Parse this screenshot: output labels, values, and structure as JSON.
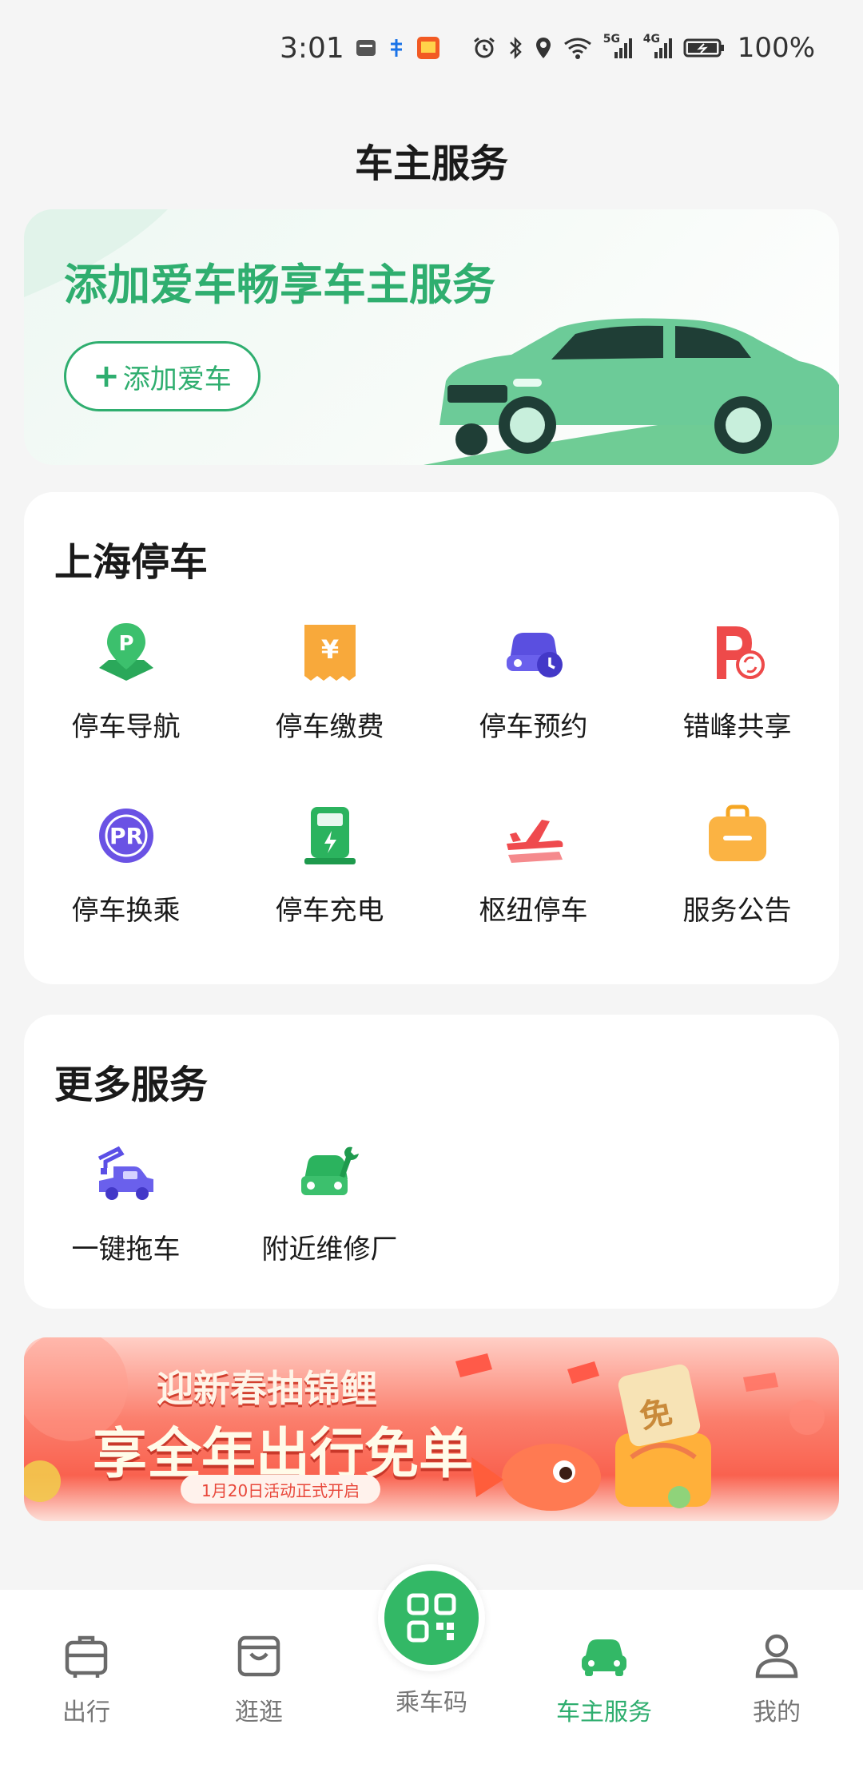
{
  "status_bar": {
    "time": "3:01",
    "battery_percent": "100%",
    "net1": "5G",
    "net2": "4G"
  },
  "page_title": "车主服务",
  "hero": {
    "title": "添加爱车畅享车主服务",
    "button_label": "添加爱车",
    "accent": "#2fae6f"
  },
  "parking_section": {
    "title": "上海停车",
    "items": [
      {
        "label": "停车导航",
        "icon": "parking-map-pin-icon"
      },
      {
        "label": "停车缴费",
        "icon": "yuan-bill-icon"
      },
      {
        "label": "停车预约",
        "icon": "car-clock-icon"
      },
      {
        "label": "错峰共享",
        "icon": "parking-share-icon"
      },
      {
        "label": "停车换乘",
        "icon": "park-and-ride-icon"
      },
      {
        "label": "停车充电",
        "icon": "charging-station-icon"
      },
      {
        "label": "枢纽停车",
        "icon": "airplane-hub-icon"
      },
      {
        "label": "服务公告",
        "icon": "notice-bag-icon"
      }
    ]
  },
  "more_section": {
    "title": "更多服务",
    "items": [
      {
        "label": "一键拖车",
        "icon": "tow-truck-icon"
      },
      {
        "label": "附近维修厂",
        "icon": "car-wrench-icon"
      }
    ]
  },
  "banner": {
    "line1": "迎新春抽锦鲤",
    "line2": "享全年出行免单",
    "pill": "1月20日活动正式开启",
    "badge": "免"
  },
  "tabbar": {
    "tabs": [
      {
        "label": "出行",
        "icon": "suitcase-icon"
      },
      {
        "label": "逛逛",
        "icon": "shopping-bag-icon"
      },
      {
        "label": "乘车码",
        "icon": "qr-code-icon"
      },
      {
        "label": "车主服务",
        "icon": "car-icon"
      },
      {
        "label": "我的",
        "icon": "person-icon"
      }
    ],
    "active_index": 3
  }
}
